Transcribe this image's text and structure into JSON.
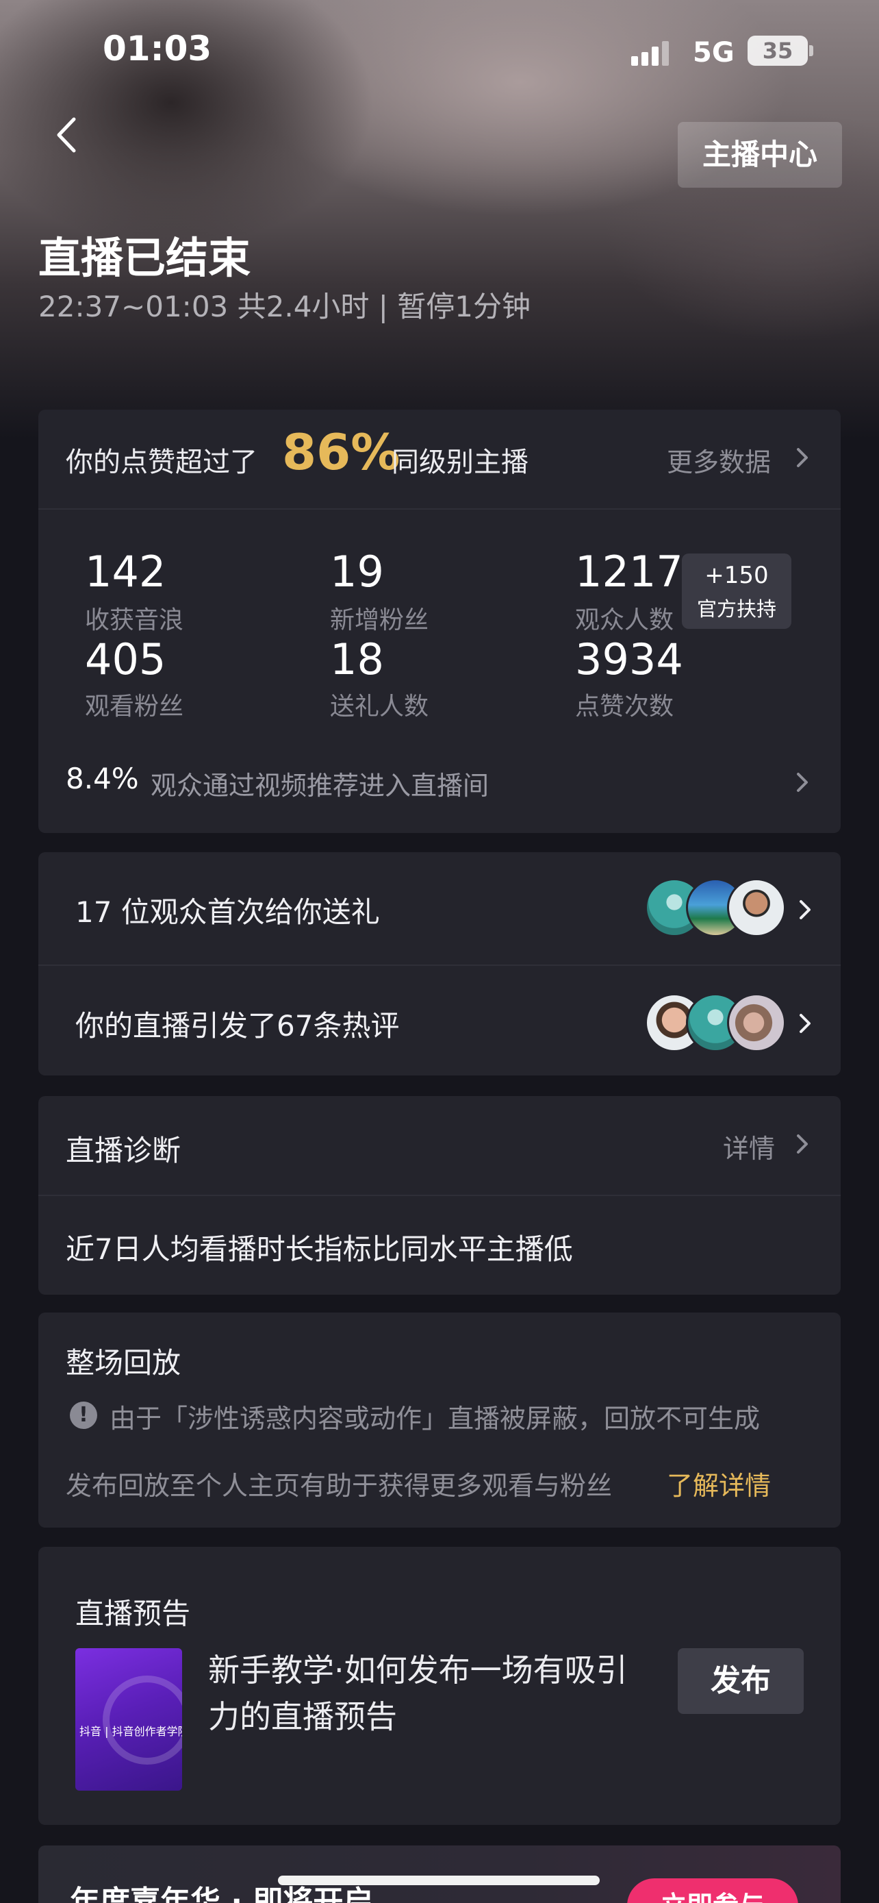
{
  "status_bar": {
    "time": "01:03",
    "network": "5G",
    "battery": "35"
  },
  "header": {
    "anchor_center_label": "主播中心",
    "title": "直播已结束",
    "session_info": "22:37~01:03 共2.4小时 | 暂停1分钟"
  },
  "summary": {
    "likes_prefix": "你的点赞超过了",
    "likes_percent": "86%",
    "likes_suffix": "同级别主播",
    "more_data_label": "更多数据",
    "stats": [
      {
        "value": "142",
        "label": "收获音浪"
      },
      {
        "value": "19",
        "label": "新增粉丝"
      },
      {
        "value": "1217",
        "label": "观众人数"
      },
      {
        "value": "405",
        "label": "观看粉丝"
      },
      {
        "value": "18",
        "label": "送礼人数"
      },
      {
        "value": "3934",
        "label": "点赞次数"
      }
    ],
    "official_badge": {
      "value": "+150",
      "label": "官方扶持"
    },
    "recommend_percent": "8.4%",
    "recommend_text": "观众通过视频推荐进入直播间"
  },
  "highlights": {
    "first_gift_text": "17 位观众首次给你送礼",
    "hot_comments_text": "你的直播引发了67条热评"
  },
  "diagnosis": {
    "title": "直播诊断",
    "details_label": "详情",
    "message": "近7日人均看播时长指标比同水平主播低"
  },
  "replay": {
    "title": "整场回放",
    "warning": "由于「涉性诱惑内容或动作」直播被屏蔽，回放不可生成",
    "hint": "发布回放至个人主页有助于获得更多观看与粉丝",
    "learn_more": "了解详情"
  },
  "preview": {
    "title": "直播预告",
    "thumbnail_label": "抖音 | 抖音创作者学院",
    "tutorial_text": "新手教学·如何发布一场有吸引力的直播预告",
    "publish_label": "发布"
  },
  "gala": {
    "title": "年度嘉年华 · 即将开启",
    "join_label": "立即参与"
  },
  "colors": {
    "accent_gold": "#e6b95a",
    "card_bg": "#24242c",
    "page_bg": "#15151c",
    "gala_button": "#ef2f6e"
  },
  "icons": [
    "back-arrow-icon",
    "chevron-right-icon",
    "warning-icon",
    "signal-icon",
    "battery-icon"
  ]
}
